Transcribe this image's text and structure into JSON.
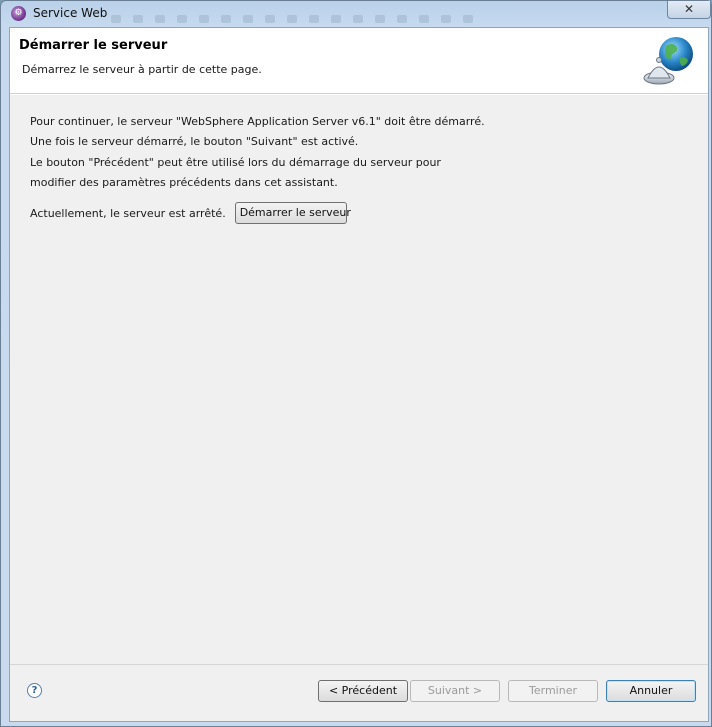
{
  "window": {
    "title": "Service Web",
    "close_label": "✕"
  },
  "header": {
    "title": "Démarrer le serveur",
    "description": "Démarrez le serveur à partir de cette page."
  },
  "content": {
    "lines": [
      "Pour continuer, le serveur \"WebSphere Application Server v6.1\" doit être démarré.",
      "Une fois le serveur démarré, le bouton \"Suivant\" est activé.",
      "Le bouton \"Précédent\" peut être utilisé lors du démarrage du serveur pour",
      "modifier des paramètres précédents dans cet assistant."
    ],
    "status_text": "Actuellement, le serveur est arrêté.",
    "start_button_label": "Démarrer le serveur"
  },
  "footer": {
    "help_symbol": "?",
    "back_label": "< Précédent",
    "next_label": "Suivant >",
    "finish_label": "Terminer",
    "cancel_label": "Annuler"
  },
  "icons": {
    "app": "eclipse-ide-icon",
    "header": "globe-server-icon",
    "help": "help-icon",
    "close": "close-icon"
  },
  "colors": {
    "title_bar": "#b9d1ea",
    "header_background": "#ffffff",
    "client_background": "#f0f0f0",
    "default_button_border": "#3c7fb1"
  }
}
